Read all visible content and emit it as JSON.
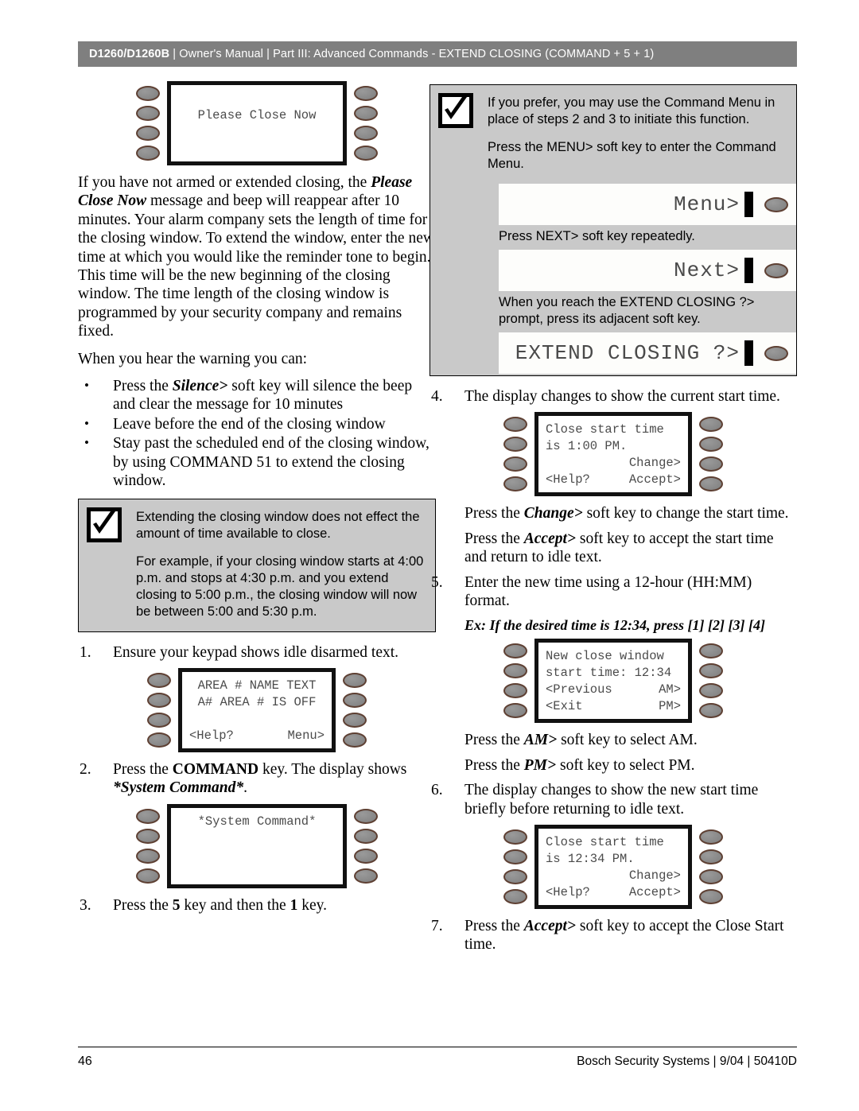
{
  "header": {
    "doc_model": "D1260/D1260B",
    "title_rest": " | Owner's Manual | Part III: Advanced Commands - EXTEND CLOSING (COMMAND + 5 + 1)",
    "bar_color": "#7f7f7f"
  },
  "left": {
    "keypad_please_close": {
      "line1": "Please Close Now"
    },
    "para_1_a": "If you have not armed or extended closing, the ",
    "para_1_b": "Please Close Now",
    "para_1_c": " message and beep will reappear after 10 minutes.  Your alarm company sets the length of time for the closing window. To extend the window, enter the new time at which you would like the reminder tone to begin. This time will be the new beginning of the closing window. The time length of the closing window is programmed by your security company and remains fixed.",
    "para_2": "When you hear the warning you can:",
    "bullets": [
      {
        "pre": "Press the ",
        "em": "Silence>",
        "post": " soft key will silence the beep and clear the message for 10 minutes"
      },
      {
        "pre": "Leave before the end of the closing window",
        "em": "",
        "post": ""
      },
      {
        "pre": "Stay past the scheduled end of the closing window, by using COMMAND 51 to extend the closing window.",
        "em": "",
        "post": ""
      }
    ],
    "note": {
      "icon": "checkmark-box-icon",
      "p1": "Extending the closing window does not effect the amount of time available to close.",
      "p2": "For example, if your closing window starts at 4:00 p.m. and stops at 4:30 p.m. and you extend closing to 5:00 p.m., the closing window will now be between 5:00 and 5:30 p.m."
    },
    "step1": {
      "num": "1.",
      "text": "Ensure your keypad shows idle disarmed text."
    },
    "keypad_idle": {
      "line1": "AREA # NAME TEXT",
      "line2": "A# AREA # IS OFF",
      "line3": "",
      "line4_left": "<Help?",
      "line4_right": "Menu>"
    },
    "step2": {
      "num": "2.",
      "pre": "Press the ",
      "bold": "COMMAND",
      "mid": " key. The display shows ",
      "em": "*System Command*",
      "post": "."
    },
    "keypad_syscmd": {
      "line1": "*System Command*"
    },
    "step3": {
      "num": "3.",
      "pre": "Press the ",
      "b1": "5",
      "mid": " key and then the ",
      "b2": "1",
      "post": " key."
    }
  },
  "right": {
    "note": {
      "icon": "checkmark-box-icon",
      "p1": "If you prefer, you may use the Command Menu in place of steps 2 and 3 to initiate this function.",
      "p2": "Press the MENU> soft key to enter the Command Menu.",
      "strip1_label": "Menu>",
      "p3": "Press NEXT> soft key repeatedly.",
      "strip2_label": "Next>",
      "p4": "When you reach the EXTEND CLOSING ?> prompt, press its adjacent soft key.",
      "strip3_label": "EXTEND CLOSING ?>"
    },
    "step4": {
      "num": "4.",
      "text": "The display changes to show the current start time."
    },
    "keypad_start_time": {
      "line1": "Close start time",
      "line2": "is 1:00 PM.",
      "line3_right": "Change>",
      "line4_left": "<Help?",
      "line4_right": "Accept>"
    },
    "sub1": {
      "pre": "Press the ",
      "em": "Change>",
      "post": " soft key to change the start time."
    },
    "sub2": {
      "pre": "Press the ",
      "em": "Accept>",
      "post": " soft key to accept the start time and return to idle text."
    },
    "step5": {
      "num": "5.",
      "text": "Enter the new time using a 12-hour (HH:MM) format."
    },
    "example": {
      "label": "Ex:",
      "text": " If the desired time is 12:34, press [1] [2] [3] [4]"
    },
    "keypad_new_window": {
      "line1": "New close window",
      "line2": "start time: 12:34",
      "line3_left": "<Previous",
      "line3_right": "AM>",
      "line4_left": "<Exit",
      "line4_right": "PM>"
    },
    "sub3": {
      "pre": "Press the ",
      "em": "AM>",
      "post": " soft key to select AM."
    },
    "sub4": {
      "pre": "Press the ",
      "em": "PM>",
      "post": " soft key to select PM."
    },
    "step6": {
      "num": "6.",
      "text": "The display changes to show the new start time briefly before returning to idle text."
    },
    "keypad_new_time": {
      "line1": "Close start time",
      "line2": "is 12:34 PM.",
      "line3_right": "Change>",
      "line4_left": "<Help?",
      "line4_right": "Accept>"
    },
    "step7": {
      "num": "7.",
      "pre": "Press the ",
      "em": "Accept>",
      "post": " soft key to accept the Close Start time."
    }
  },
  "footer": {
    "page_number": "46",
    "credit": "Bosch Security Systems | 9/04 | 50410D"
  }
}
